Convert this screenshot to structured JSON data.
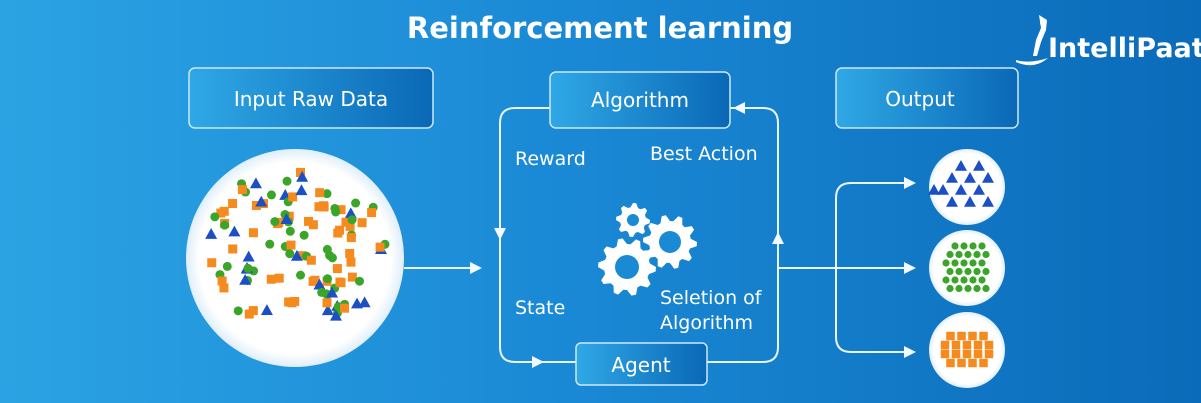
{
  "title": "Reinforcement learning",
  "logo": {
    "text": "IntelliPaat"
  },
  "boxes": {
    "input": "Input Raw Data",
    "algorithm": "Algorithm",
    "agent": "Agent",
    "output": "Output"
  },
  "loop_labels": {
    "reward": "Reward",
    "best_action": "Best Action",
    "state": "State",
    "selection_line1": "Seletion of",
    "selection_line2": "Algorithm"
  },
  "icons": [
    "gears-icon",
    "logo-person-icon"
  ],
  "colors": {
    "background_left": "#2ba3e3",
    "background_right": "#0a6bb9",
    "triangle": "#1d4fc4",
    "circle": "#3aa529",
    "square": "#f58a1f"
  },
  "output_clusters": [
    "triangles",
    "circles",
    "squares"
  ]
}
